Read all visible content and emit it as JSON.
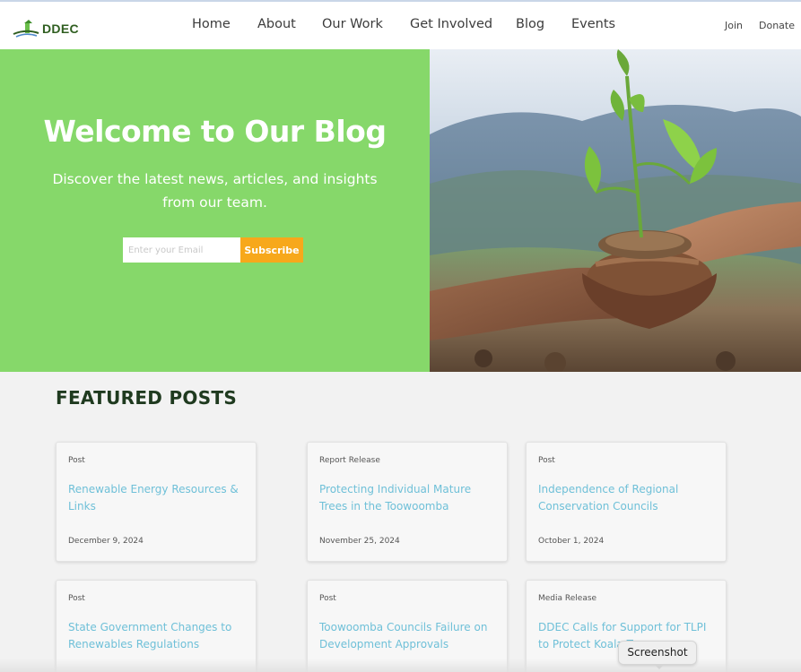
{
  "brand": {
    "name": "DDEC",
    "accent": "#86d86a",
    "button_color": "#f7a81b",
    "link_color": "#6fc0d8"
  },
  "nav": {
    "items": [
      {
        "label": "Home"
      },
      {
        "label": "About"
      },
      {
        "label": "Our Work"
      },
      {
        "label": "Get Involved"
      },
      {
        "label": "Blog"
      },
      {
        "label": "Events"
      }
    ],
    "join_label": "Join",
    "donate_label": "Donate"
  },
  "hero": {
    "title": "Welcome to Our Blog",
    "subtitle": "Discover the latest news, articles, and insights from our team.",
    "email_placeholder": "Enter your Email",
    "subscribe_label": "Subscribe",
    "image": "hands-holding-seedling-photo"
  },
  "featured": {
    "heading": "FEATURED POSTS",
    "posts": [
      {
        "category": "Post",
        "title": "Renewable Energy Resources & Links",
        "date": "December 9, 2024"
      },
      {
        "category": "Report Release",
        "title": "Protecting Individual Mature Trees in the Toowoomba",
        "date": "November 25, 2024"
      },
      {
        "category": "Post",
        "title": "Independence of Regional Conservation Councils",
        "date": "October 1, 2024"
      },
      {
        "category": "Post",
        "title": "State Government Changes to Renewables Regulations",
        "date": ""
      },
      {
        "category": "Post",
        "title": "Toowoomba Councils Failure on Development Approvals",
        "date": ""
      },
      {
        "category": "Media Release",
        "title": "DDEC Calls for Support for TLPI to Protect Koala Trees",
        "date": ""
      }
    ]
  },
  "tooltip": {
    "label": "Screenshot"
  }
}
